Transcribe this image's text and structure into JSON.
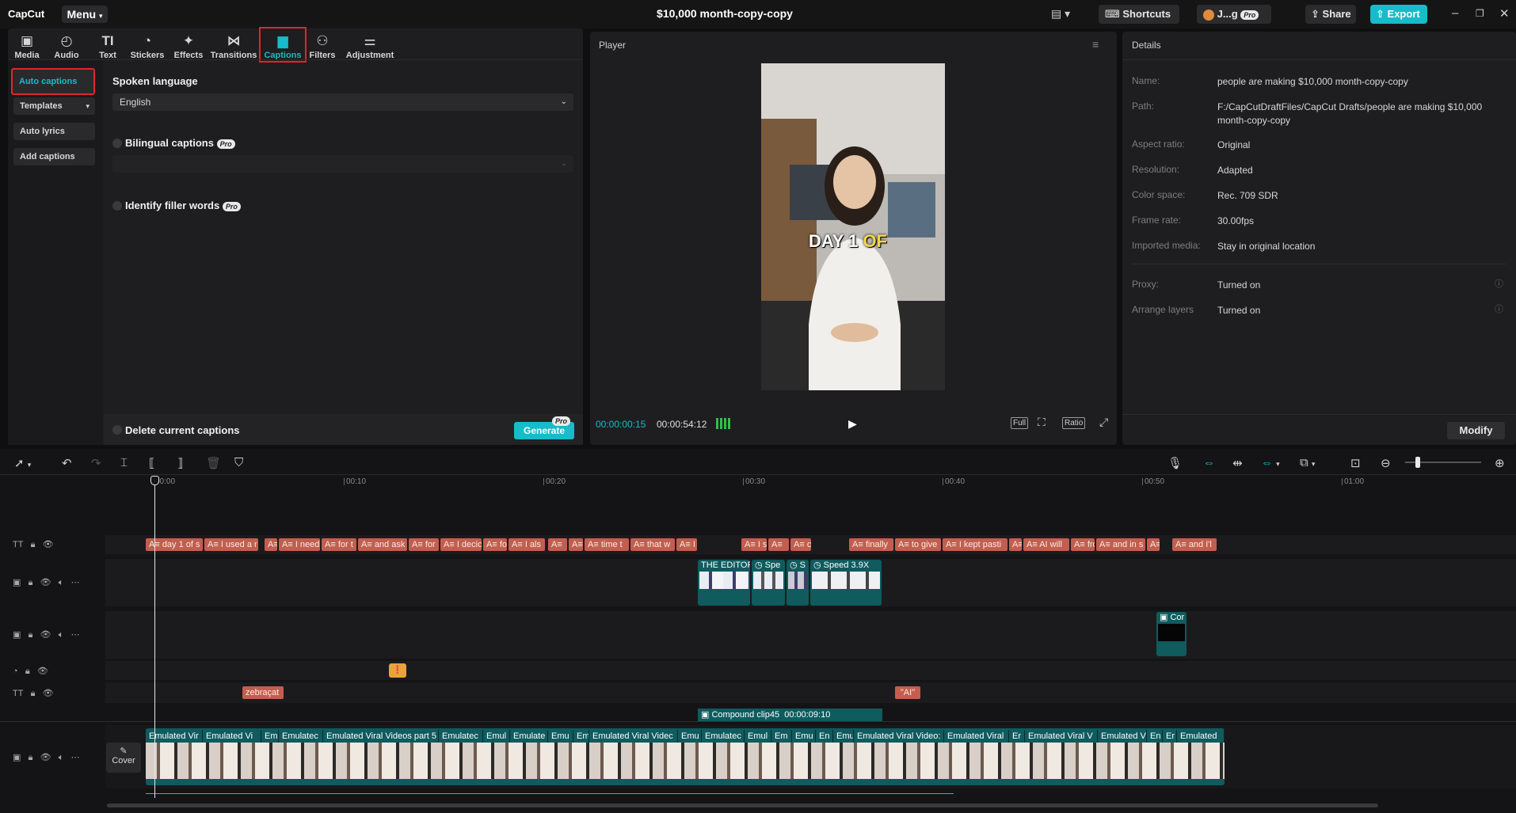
{
  "app": {
    "logo": "CapCut",
    "menu_label": "Menu",
    "project_title": "$10,000 month-copy-copy"
  },
  "titlebar": {
    "shortcuts_label": "Shortcuts",
    "user_label": "J...g",
    "pro_badge": "Pro",
    "share_label": "Share",
    "export_label": "Export"
  },
  "tools": [
    {
      "label": "Media",
      "icon": "media-icon"
    },
    {
      "label": "Audio",
      "icon": "audio-icon"
    },
    {
      "label": "Text",
      "icon": "text-icon"
    },
    {
      "label": "Stickers",
      "icon": "stickers-icon"
    },
    {
      "label": "Effects",
      "icon": "effects-icon"
    },
    {
      "label": "Transitions",
      "icon": "transitions-icon"
    },
    {
      "label": "Captions",
      "icon": "captions-icon",
      "active": true
    },
    {
      "label": "Filters",
      "icon": "filters-icon"
    },
    {
      "label": "Adjustment",
      "icon": "adjustment-icon"
    }
  ],
  "captions_panel": {
    "side_items": [
      "Auto captions",
      "Templates",
      "Auto lyrics",
      "Add captions"
    ],
    "spoken_language_label": "Spoken language",
    "spoken_language_value": "English",
    "bilingual_label": "Bilingual captions",
    "filler_label": "Identify filler words",
    "pro": "Pro",
    "delete_label": "Delete current captions",
    "generate_label": "Generate"
  },
  "player": {
    "title": "Player",
    "current_time": "00:00:00:15",
    "total_time": "00:00:54:12",
    "overlay_text_white": "DAY 1 ",
    "overlay_text_yellow": "OF",
    "full_label": "Full",
    "ratio_label": "Ratio"
  },
  "details": {
    "title": "Details",
    "rows": [
      {
        "key": "Name:",
        "value": "people are making $10,000 month-copy-copy"
      },
      {
        "key": "Path:",
        "value": "F:/CapCutDraftFiles/CapCut Drafts/people are making $10,000 month-copy-copy"
      },
      {
        "key": "Aspect ratio:",
        "value": "Original"
      },
      {
        "key": "Resolution:",
        "value": "Adapted"
      },
      {
        "key": "Color space:",
        "value": "Rec. 709 SDR"
      },
      {
        "key": "Frame rate:",
        "value": "30.00fps"
      },
      {
        "key": "Imported media:",
        "value": "Stay in original location"
      },
      {
        "key": "Proxy:",
        "value": "Turned on"
      },
      {
        "key": "Arrange layers",
        "value": "Turned on"
      }
    ],
    "modify_label": "Modify"
  },
  "timeline": {
    "ruler": [
      "00:00",
      "00:10",
      "00:20",
      "00:30",
      "00:40",
      "00:50",
      "01:00"
    ],
    "caption_chips": [
      "day 1 of s",
      "I used a r",
      "",
      "I need",
      "for t",
      "and ask",
      "for",
      "I decic",
      "fo",
      "I als",
      "",
      "",
      "time t",
      "that w",
      "I",
      "I s",
      "",
      "c",
      "finally",
      "to give",
      "I kept pasti",
      "",
      "AI will",
      "fro",
      "and in s",
      "",
      "and I'l"
    ],
    "overlay_clips": [
      "THE EDITOR",
      "Spe",
      "S",
      "Speed 3.9X",
      "Cor"
    ],
    "text_chips": [
      "zebraçat",
      "\"AI\""
    ],
    "compound_label": "Compound clip45",
    "compound_duration": "00:00:09:10",
    "main_chips": [
      "Emulated Vir",
      "Emulated Vi",
      "Em",
      "Emulatec",
      "Emulated Viral Videos part 5",
      "Emulatec",
      "Emul",
      "Emulate",
      "Emu",
      "Em",
      "Emulated Viral Videc",
      "Emu",
      "Emulatec",
      "Emul",
      "Em",
      "Emu",
      "En",
      "Emu",
      "Emulated Viral Video:",
      "Emulated Viral",
      "Er",
      "Emulated Viral V",
      "Emulated V",
      "En",
      "Er",
      "Emulated"
    ],
    "cover_label": "Cover"
  },
  "colors": {
    "accent": "#16bcc9",
    "caption_chip": "#c35e4f",
    "clip": "#0f5b5e",
    "highlight_box": "#e0262a"
  }
}
